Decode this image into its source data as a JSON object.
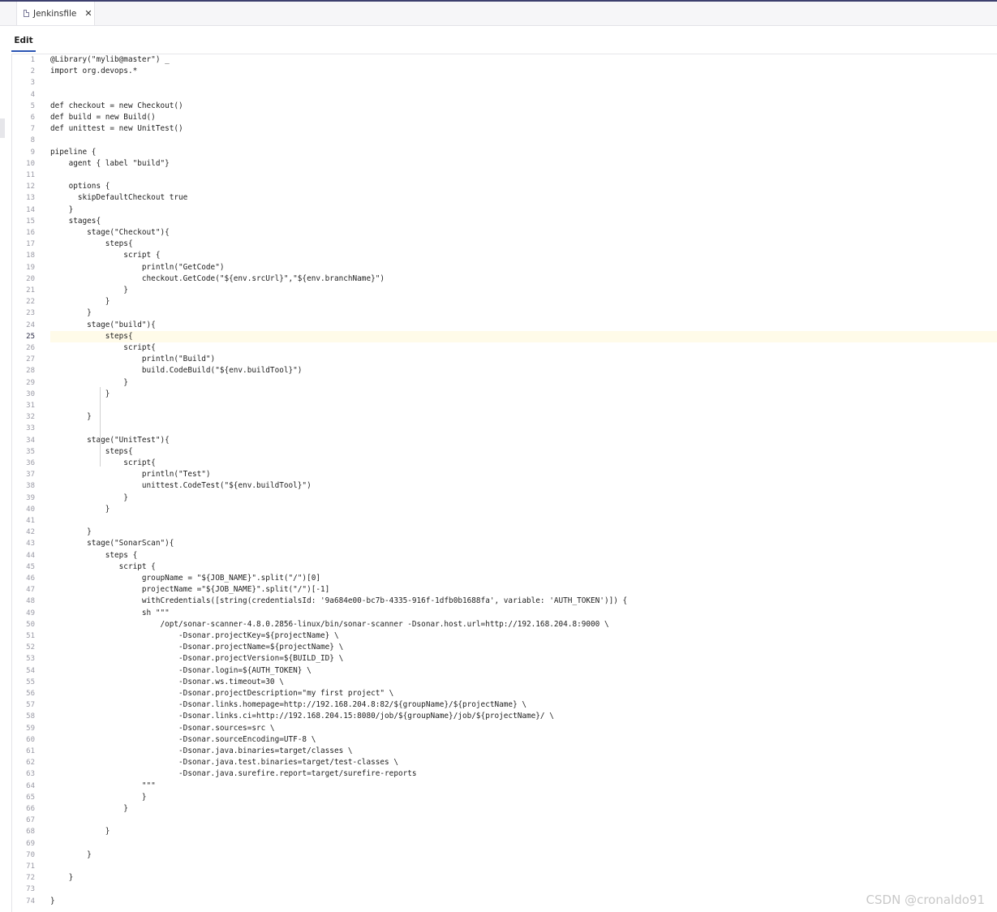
{
  "tab": {
    "filename": "Jenkinsfile",
    "close_glyph": "✕"
  },
  "toolbar": {
    "edit_label": "Edit"
  },
  "watermark": "CSDN @cronaldo91",
  "editor": {
    "active_line": 25,
    "lines": [
      "@Library(\"mylib@master\") _",
      "import org.devops.*",
      "",
      "",
      "def checkout = new Checkout()",
      "def build = new Build()",
      "def unittest = new UnitTest()",
      "",
      "pipeline {",
      "    agent { label \"build\"}",
      "",
      "    options {",
      "      skipDefaultCheckout true",
      "    }",
      "    stages{",
      "        stage(\"Checkout\"){",
      "            steps{",
      "                script {",
      "                    println(\"GetCode\")",
      "                    checkout.GetCode(\"${env.srcUrl}\",\"${env.branchName}\")",
      "                }",
      "            }",
      "        }",
      "        stage(\"build\"){",
      "            steps{",
      "                script{",
      "                    println(\"Build\")",
      "                    build.CodeBuild(\"${env.buildTool}\")",
      "                }",
      "            }",
      "",
      "        }",
      "",
      "        stage(\"UnitTest\"){",
      "            steps{",
      "                script{",
      "                    println(\"Test\")",
      "                    unittest.CodeTest(\"${env.buildTool}\")",
      "                }",
      "            }",
      "",
      "        }",
      "        stage(\"SonarScan\"){",
      "            steps {",
      "               script {",
      "                    groupName = \"${JOB_NAME}\".split(\"/\")[0]",
      "                    projectName =\"${JOB_NAME}\".split(\"/\")[-1]",
      "                    withCredentials([string(credentialsId: '9a684e00-bc7b-4335-916f-1dfb0b1688fa', variable: 'AUTH_TOKEN')]) {",
      "                    sh \"\"\"",
      "                        /opt/sonar-scanner-4.8.0.2856-linux/bin/sonar-scanner -Dsonar.host.url=http://192.168.204.8:9000 \\",
      "                            -Dsonar.projectKey=${projectName} \\",
      "                            -Dsonar.projectName=${projectName} \\",
      "                            -Dsonar.projectVersion=${BUILD_ID} \\",
      "                            -Dsonar.login=${AUTH_TOKEN} \\",
      "                            -Dsonar.ws.timeout=30 \\",
      "                            -Dsonar.projectDescription=\"my first project\" \\",
      "                            -Dsonar.links.homepage=http://192.168.204.8:82/${groupName}/${projectName} \\",
      "                            -Dsonar.links.ci=http://192.168.204.15:8080/job/${groupName}/job/${projectName}/ \\",
      "                            -Dsonar.sources=src \\",
      "                            -Dsonar.sourceEncoding=UTF-8 \\",
      "                            -Dsonar.java.binaries=target/classes \\",
      "                            -Dsonar.java.test.binaries=target/test-classes \\",
      "                            -Dsonar.java.surefire.report=target/surefire-reports",
      "                    \"\"\"",
      "                    }",
      "                }",
      "",
      "            }",
      "",
      "        }",
      "",
      "    }",
      "",
      "}"
    ]
  }
}
